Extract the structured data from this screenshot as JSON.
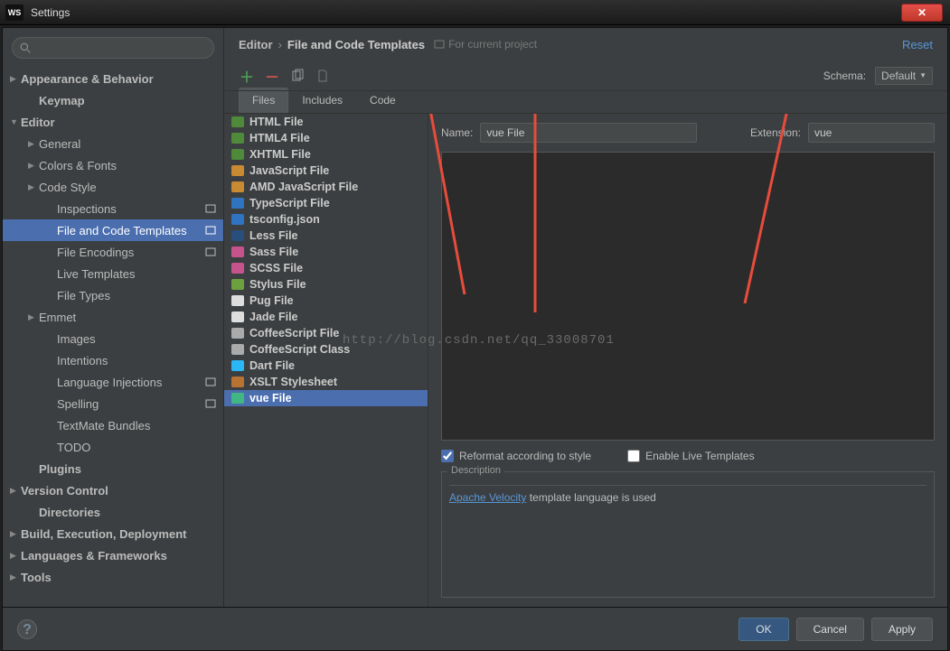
{
  "titlebar": {
    "logo": "WS",
    "title": "Settings",
    "close": "✕"
  },
  "sidebar": {
    "items": [
      {
        "label": "Appearance & Behavior",
        "kind": "bold",
        "indent": 0,
        "arrow": "▶"
      },
      {
        "label": "Keymap",
        "kind": "bold",
        "indent": 1,
        "arrow": ""
      },
      {
        "label": "Editor",
        "kind": "bold",
        "indent": 0,
        "arrow": "▼"
      },
      {
        "label": "General",
        "kind": "",
        "indent": 1,
        "arrow": "▶"
      },
      {
        "label": "Colors & Fonts",
        "kind": "",
        "indent": 1,
        "arrow": "▶"
      },
      {
        "label": "Code Style",
        "kind": "",
        "indent": 1,
        "arrow": "▶"
      },
      {
        "label": "Inspections",
        "kind": "",
        "indent": 2,
        "arrow": "",
        "note": true
      },
      {
        "label": "File and Code Templates",
        "kind": "",
        "indent": 2,
        "arrow": "",
        "note": true,
        "selected": true
      },
      {
        "label": "File Encodings",
        "kind": "",
        "indent": 2,
        "arrow": "",
        "note": true
      },
      {
        "label": "Live Templates",
        "kind": "",
        "indent": 2,
        "arrow": ""
      },
      {
        "label": "File Types",
        "kind": "",
        "indent": 2,
        "arrow": ""
      },
      {
        "label": "Emmet",
        "kind": "",
        "indent": 1,
        "arrow": "▶"
      },
      {
        "label": "Images",
        "kind": "",
        "indent": 2,
        "arrow": ""
      },
      {
        "label": "Intentions",
        "kind": "",
        "indent": 2,
        "arrow": ""
      },
      {
        "label": "Language Injections",
        "kind": "",
        "indent": 2,
        "arrow": "",
        "note": true
      },
      {
        "label": "Spelling",
        "kind": "",
        "indent": 2,
        "arrow": "",
        "note": true
      },
      {
        "label": "TextMate Bundles",
        "kind": "",
        "indent": 2,
        "arrow": ""
      },
      {
        "label": "TODO",
        "kind": "",
        "indent": 2,
        "arrow": ""
      },
      {
        "label": "Plugins",
        "kind": "bold",
        "indent": 1,
        "arrow": ""
      },
      {
        "label": "Version Control",
        "kind": "bold",
        "indent": 0,
        "arrow": "▶"
      },
      {
        "label": "Directories",
        "kind": "bold",
        "indent": 1,
        "arrow": ""
      },
      {
        "label": "Build, Execution, Deployment",
        "kind": "bold",
        "indent": 0,
        "arrow": "▶"
      },
      {
        "label": "Languages & Frameworks",
        "kind": "bold",
        "indent": 0,
        "arrow": "▶"
      },
      {
        "label": "Tools",
        "kind": "bold",
        "indent": 0,
        "arrow": "▶"
      }
    ]
  },
  "breadcrumb": {
    "root": "Editor",
    "page": "File and Code Templates",
    "scope": "For current project",
    "reset": "Reset"
  },
  "toolbar": {
    "schema_label": "Schema:",
    "schema_value": "Default"
  },
  "tabs": [
    "Files",
    "Includes",
    "Code"
  ],
  "active_tab": 0,
  "files": [
    {
      "label": "HTML File",
      "color": "#4e8a3a"
    },
    {
      "label": "HTML4 File",
      "color": "#4e8a3a"
    },
    {
      "label": "XHTML File",
      "color": "#4e8a3a"
    },
    {
      "label": "JavaScript File",
      "color": "#c88a32"
    },
    {
      "label": "AMD JavaScript File",
      "color": "#c88a32"
    },
    {
      "label": "TypeScript File",
      "color": "#2f74c0"
    },
    {
      "label": "tsconfig.json",
      "color": "#2f74c0"
    },
    {
      "label": "Less File",
      "color": "#294e7b"
    },
    {
      "label": "Sass File",
      "color": "#c6538c"
    },
    {
      "label": "SCSS File",
      "color": "#c6538c"
    },
    {
      "label": "Stylus File",
      "color": "#6da13f"
    },
    {
      "label": "Pug File",
      "color": "#dddddd"
    },
    {
      "label": "Jade File",
      "color": "#dddddd"
    },
    {
      "label": "CoffeeScript File",
      "color": "#aaaaaa"
    },
    {
      "label": "CoffeeScript Class",
      "color": "#aaaaaa"
    },
    {
      "label": "Dart File",
      "color": "#2bb7f6"
    },
    {
      "label": "XSLT Stylesheet",
      "color": "#b87333"
    },
    {
      "label": "vue File",
      "color": "#41b883",
      "selected": true
    }
  ],
  "detail": {
    "name_label": "Name:",
    "name_value": "vue File",
    "ext_label": "Extension:",
    "ext_value": "vue",
    "reformat": "Reformat according to style",
    "live_templates": "Enable Live Templates",
    "desc_title": "Description",
    "desc_link": "Apache Velocity",
    "desc_rest": " template language is used"
  },
  "buttons": {
    "ok": "OK",
    "cancel": "Cancel",
    "apply": "Apply",
    "help": "?"
  },
  "watermark": "http://blog.csdn.net/qq_33008701"
}
